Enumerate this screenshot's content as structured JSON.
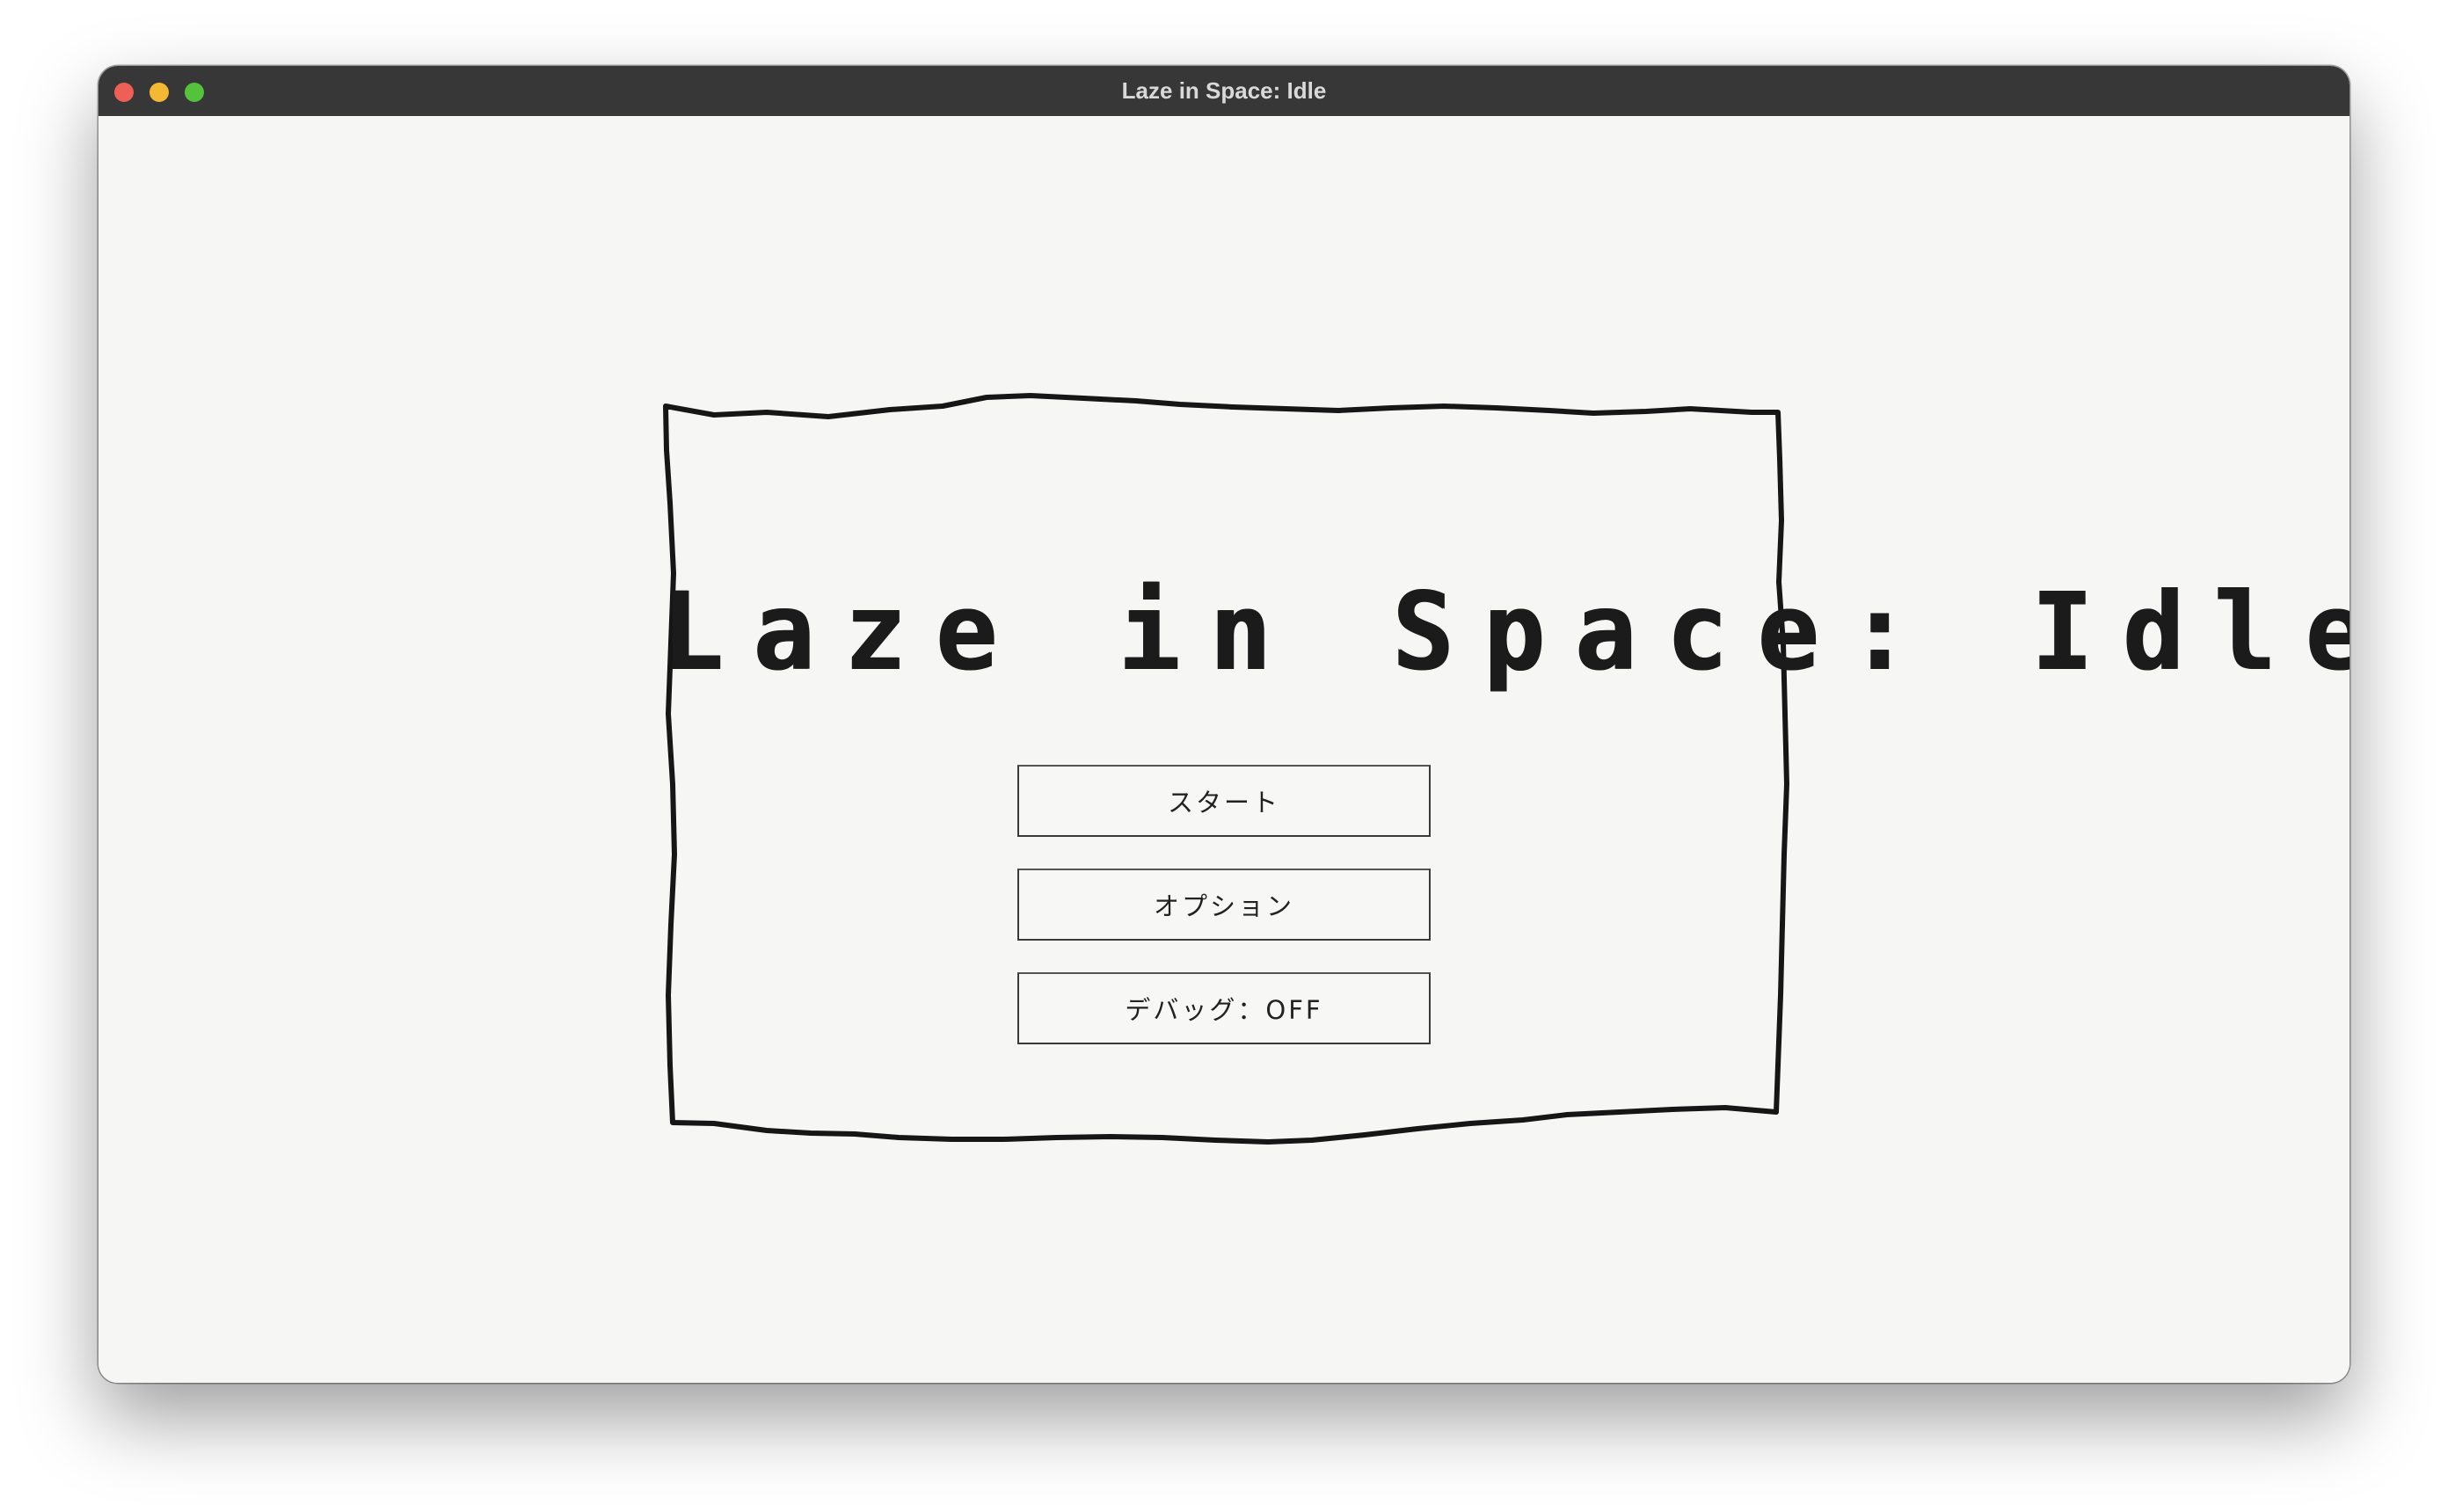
{
  "window": {
    "title": "Laze in Space: Idle"
  },
  "game": {
    "title": "Laze in Space: Idle"
  },
  "menu": {
    "start_label": "スタート",
    "options_label": "オプション",
    "debug_label": "デバッグ：OFF"
  },
  "colors": {
    "titlebar": "#373737",
    "background": "#f6f6f5",
    "ink": "#1b1b1b",
    "close": "#ee5f56",
    "minimize": "#f3b935",
    "maximize": "#55c23c"
  }
}
